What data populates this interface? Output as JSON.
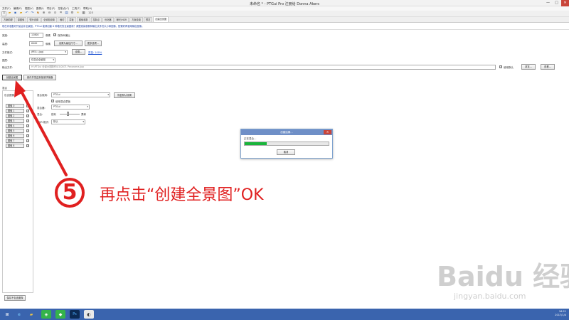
{
  "window": {
    "title": "未命名 * - PTGui Pro 注册给 Donna Akers",
    "minimize": "—",
    "maximize": "□",
    "close": "✕"
  },
  "menu": [
    "文件(F)",
    "编辑(E)",
    "视图(V)",
    "图像(I)",
    "项目(P)",
    "控制点(C)",
    "工具(T)",
    "帮助(H)"
  ],
  "toolbar": {
    "icons": [
      "new-icon",
      "open-icon",
      "save-icon",
      "project-icon",
      "undo-icon",
      "redo-icon",
      "editor-icon",
      "zoom-in-icon",
      "zoom-out-icon",
      "zoom-fit-icon",
      "crop-icon",
      "panorama-icon",
      "settings-icon",
      "lightbulb-icon",
      "layers-icon",
      "number-icon"
    ],
    "number_label": "123"
  },
  "tabs": [
    "方案助理",
    "源图像",
    "镜头设置",
    "全景图设置",
    "裁切",
    "蒙板",
    "图像参数",
    "控制点",
    "优化器",
    "曝光/HDR",
    "方案设置",
    "预览",
    "创建全景图"
  ],
  "active_tab": "创建全景图",
  "hint": "现在你准备好开始合并全景图。PTGui 能够创建 8 种格式的全景图像？调整渲染参数和输出文件的大小和图像，配置好再使用输出图像。",
  "form": {
    "width_label": "宽度:",
    "width_value": "12800",
    "width_unit": "像素",
    "keep_ratio_label": "保持纵横比",
    "height_label": "高度:",
    "height_value": "6400",
    "height_unit": "像素",
    "set_optimal_button": "设置为最佳尺寸…",
    "more_button": "更多选项…",
    "format_label": "文件格式:",
    "format_value": "JPEG (.jpg)",
    "format_settings_button": "设置…",
    "quality_link": "质量: 100%",
    "layout_label": "图层:",
    "layout_value": "仅混合全景图",
    "output_label": "输出文件:",
    "output_value": "H:\\PTGui 全景大图制作\\01\\0071 Panorama.jpg",
    "use_default_label": "使用默认",
    "browse_button": "浏览…",
    "view_button": "查看…"
  },
  "actions": {
    "create_button": "创建全景图",
    "save_batch_button": "保存并发送到批量拼接器"
  },
  "left_panel": {
    "header": "混合",
    "images_label": "包含图像:",
    "images": [
      "图像 0",
      "图像 1",
      "图像 2",
      "图像 3",
      "图像 4",
      "图像 5",
      "图像 6",
      "图像 7",
      "图像 8"
    ],
    "bottom_button": "保存不包含图像"
  },
  "blend": {
    "blender_label": "混合使用:",
    "blender_value": "PTGui",
    "default_settings_button": "恢复默认设置",
    "use_mask_label": "使用混合蒙板",
    "blend_method_label": "混合器:",
    "blend_method_value": "PTGui",
    "smooth_label": "混合:",
    "smooth_low": "锐利",
    "smooth_high": "柔和",
    "hdr_label": "HDR 格式:",
    "hdr_value": "默认"
  },
  "dialog": {
    "title": "创建结果…",
    "message": "正在混合…",
    "progress": 0.26,
    "cancel_button": "取消"
  },
  "taskbar": {
    "icons": [
      "windows-start-icon",
      "internet-explorer-icon",
      "file-explorer-icon",
      "shield-icon",
      "photoshop-icon",
      "ptgui-icon"
    ],
    "time": "16:21",
    "date": "2017/1/4"
  },
  "annotation": {
    "step_number": "5",
    "text": "再点击“创建全景图”OK",
    "color": "#e02020"
  },
  "watermark": {
    "brand": "Baidu 经验",
    "url": "jingyan.baidu.com"
  },
  "colors": {
    "accent": "#1a4fd0",
    "progress": "#19b53b",
    "taskbar": "#3a64ae",
    "annotation": "#e02020"
  }
}
